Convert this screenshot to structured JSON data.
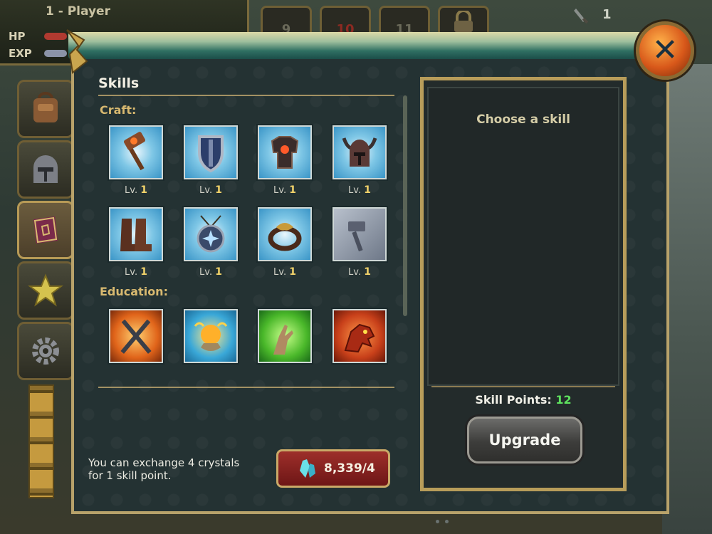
{
  "hud": {
    "player": "1 - Player",
    "hp_label": "HP",
    "exp_label": "EXP",
    "slots": [
      "9",
      "10",
      "11"
    ],
    "sword_count": "1"
  },
  "skills": {
    "title": "Skills",
    "craft_label": "Craft:",
    "education_label": "Education:",
    "lv_prefix": "Lv.",
    "craft": [
      {
        "icon": "hammer-icon",
        "level": "1"
      },
      {
        "icon": "shield-icon",
        "level": "1"
      },
      {
        "icon": "armor-icon",
        "level": "1"
      },
      {
        "icon": "helmet-icon",
        "level": "1"
      },
      {
        "icon": "boots-icon",
        "level": "1"
      },
      {
        "icon": "amulet-icon",
        "level": "1"
      },
      {
        "icon": "ring-icon",
        "level": "1"
      },
      {
        "icon": "anvil-hammer-icon",
        "level": "1"
      }
    ],
    "education": [
      {
        "icon": "crossed-swords-icon"
      },
      {
        "icon": "magic-orb-icon"
      },
      {
        "icon": "hand-icon"
      },
      {
        "icon": "dragon-icon"
      }
    ],
    "exchange_note_line1": "You can exchange 4 crystals",
    "exchange_note_line2": "for 1 skill point.",
    "crystal_value": "8,339/4"
  },
  "detail": {
    "choose": "Choose a skill",
    "skill_points_label": "Skill Points:",
    "skill_points_value": "12",
    "upgrade_label": "Upgrade"
  },
  "colors": {
    "accent_gold": "#d8b970",
    "skill_points_green": "#5ee25e",
    "close_orange": "#d8581a"
  }
}
